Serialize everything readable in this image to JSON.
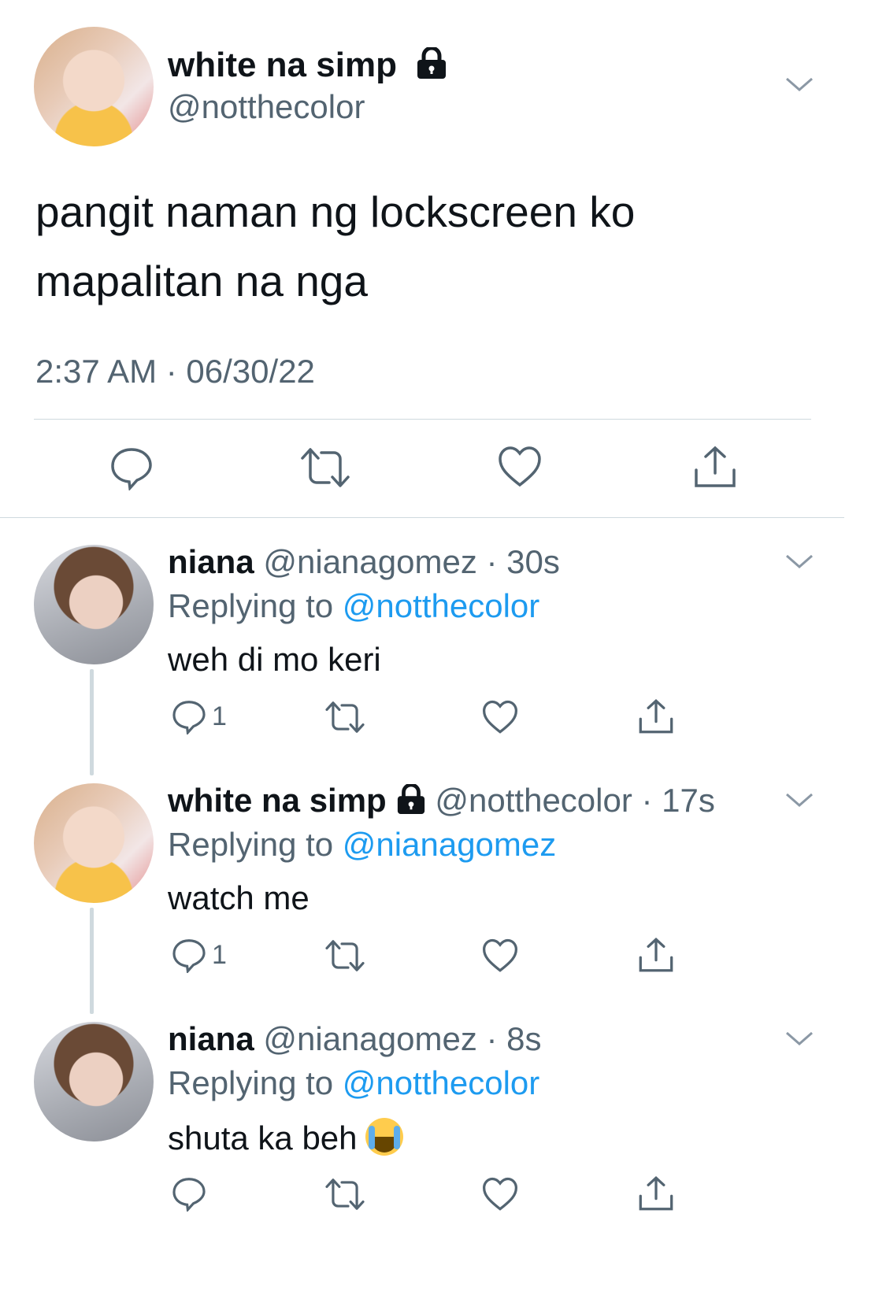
{
  "main_tweet": {
    "display_name": "white na simp",
    "handle": "@notthecolor",
    "text_line1": "pangit naman ng lockscreen ko",
    "text_line2": "mapalitan na nga",
    "timestamp": "2:37 AM · 06/30/22"
  },
  "replies": [
    {
      "display_name": "niana",
      "handle": "@nianagomez",
      "time": "30s",
      "replying_label": "Replying to",
      "replying_to": "@notthecolor",
      "text": "weh di mo keri",
      "reply_count": "1"
    },
    {
      "display_name": "white na simp",
      "handle": "@notthecolor",
      "time": "17s",
      "replying_label": "Replying to",
      "replying_to": "@nianagomez",
      "text": "watch me",
      "reply_count": "1"
    },
    {
      "display_name": "niana",
      "handle": "@nianagomez",
      "time": "8s",
      "replying_label": "Replying to",
      "replying_to": "@notthecolor",
      "text": "shuta ka beh",
      "reply_count": ""
    }
  ],
  "colors": {
    "link": "#1d9bf0",
    "muted": "#536471",
    "divider": "#cfd9de"
  },
  "icons": [
    "lock-icon",
    "chevron-down-icon",
    "reply-icon",
    "retweet-icon",
    "like-icon",
    "share-icon",
    "loudly-crying-face-emoji"
  ]
}
